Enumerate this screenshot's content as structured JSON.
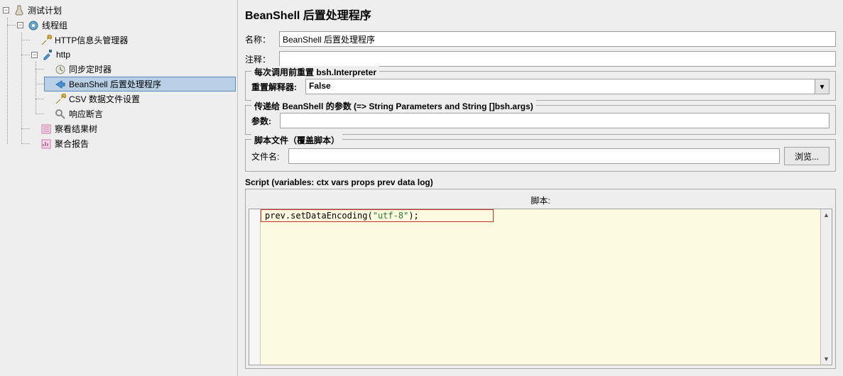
{
  "tree": {
    "root": "测试计划",
    "thread_group": "线程组",
    "http_header": "HTTP信息头管理器",
    "http": "http",
    "sync_timer": "同步定时器",
    "beanshell": "BeanShell 后置处理程序",
    "csv": "CSV 数据文件设置",
    "assert": "响应断言",
    "result_tree": "察看结果树",
    "agg_report": "聚合报告"
  },
  "panel": {
    "title": "BeanShell 后置处理程序",
    "name_label": "名称：",
    "name_value": "BeanShell 后置处理程序",
    "comment_label": "注释：",
    "comment_value": "",
    "reset_group_title": "每次调用前重置 bsh.Interpreter",
    "reset_label": "重置解释器:",
    "reset_value": "False",
    "params_group_title": "传递给 BeanShell 的参数 (=> String Parameters and String []bsh.args)",
    "params_label": "参数:",
    "params_value": "",
    "scriptfile_group_title": "脚本文件（覆盖脚本）",
    "file_label": "文件名:",
    "file_value": "",
    "browse_btn": "浏览...",
    "script_label": "Script (variables: ctx vars props prev data log)",
    "script_header": "脚本:",
    "script_code_method": "prev.setDataEncoding",
    "script_code_paren_open": "(",
    "script_code_str": "\"utf-8\"",
    "script_code_close": ");"
  }
}
